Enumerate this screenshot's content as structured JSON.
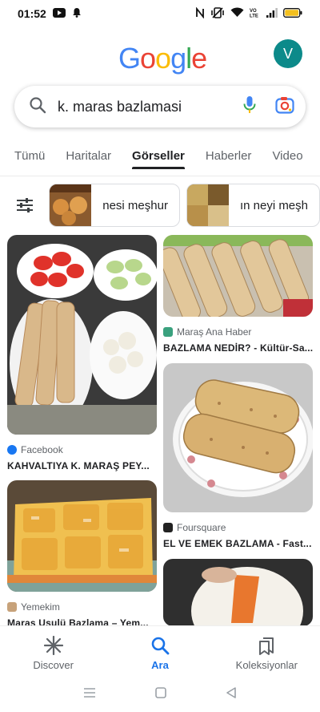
{
  "status_bar": {
    "time": "01:52",
    "icons": [
      "youtube-icon",
      "notification-bell-icon",
      "nfc-icon",
      "vibrate-icon",
      "wifi-icon",
      "volte-icon",
      "signal-icon",
      "battery-icon"
    ]
  },
  "header": {
    "logo_letters": [
      {
        "ch": "G",
        "color": "#4285F4"
      },
      {
        "ch": "o",
        "color": "#EA4335"
      },
      {
        "ch": "o",
        "color": "#FBBC05"
      },
      {
        "ch": "g",
        "color": "#4285F4"
      },
      {
        "ch": "l",
        "color": "#34A853"
      },
      {
        "ch": "e",
        "color": "#EA4335"
      }
    ],
    "avatar_initial": "V",
    "avatar_color": "#0c8a8a"
  },
  "search": {
    "query": "k. maras bazlamasi"
  },
  "tabs": [
    {
      "label": "Tümü",
      "active": false
    },
    {
      "label": "Haritalar",
      "active": false
    },
    {
      "label": "Görseller",
      "active": true
    },
    {
      "label": "Haberler",
      "active": false
    },
    {
      "label": "Video",
      "active": false
    }
  ],
  "chips": [
    {
      "label": "nesi meşhur"
    },
    {
      "label": "ın neyi meşh"
    }
  ],
  "results": [
    {
      "source": "Facebook",
      "title": "KAHVALTIYA K. MARAŞ PEY...",
      "favicon_color": "#1877F2"
    },
    {
      "source": "Maraş Ana Haber",
      "title": "BAZLAMA NEDİR? - Kültür-Sa...",
      "favicon_color": "#3aa17e"
    },
    {
      "source": "Foursquare",
      "title": "EL VE EMEK BAZLAMA - Fast...",
      "favicon_color": "#222222"
    },
    {
      "source": "Yemekim",
      "title": "Maraş Usulü Bazlama – Yem...",
      "favicon_color": "#c7a27a"
    }
  ],
  "bottom_nav": [
    {
      "label": "Discover",
      "icon": "asterisk-icon",
      "active": false
    },
    {
      "label": "Ara",
      "icon": "search-icon",
      "active": true
    },
    {
      "label": "Koleksiyonlar",
      "icon": "bookmarks-icon",
      "active": false
    }
  ],
  "colors": {
    "accent": "#1a73e8",
    "text": "#202124",
    "muted": "#5f6368"
  }
}
